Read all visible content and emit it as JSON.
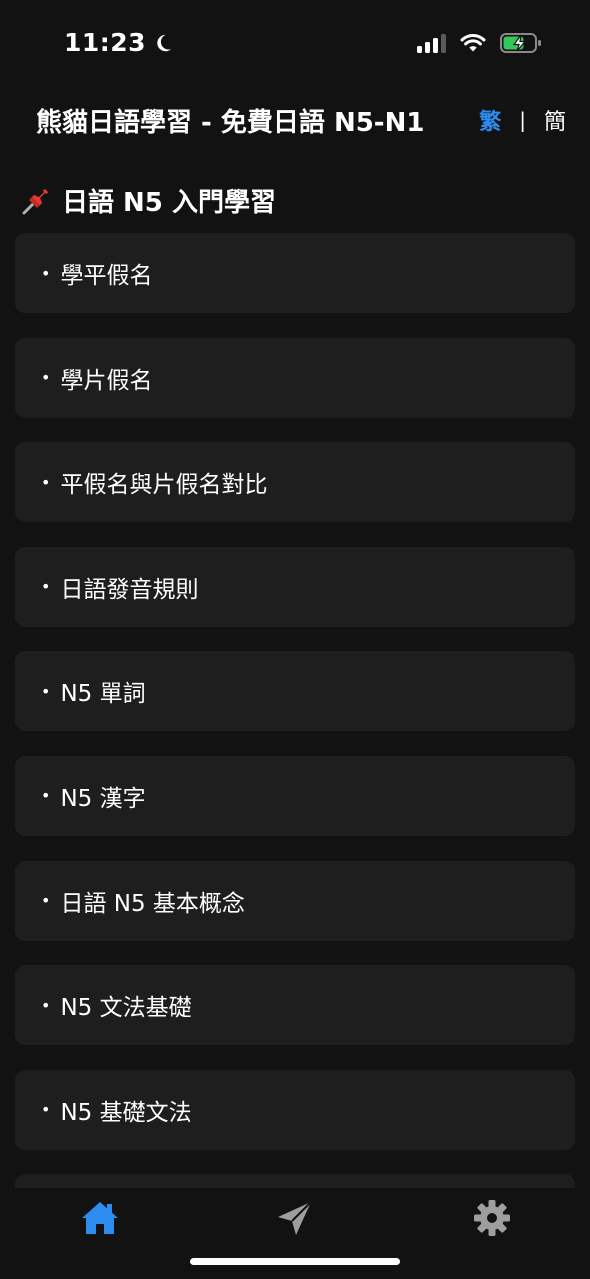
{
  "status_bar": {
    "time": "11:23",
    "icons": [
      "moon-icon",
      "cellular-signal-icon",
      "wifi-icon",
      "battery-charging-icon"
    ]
  },
  "header": {
    "title": "熊貓日語學習 - 免費日語 N5-N1",
    "lang_traditional": "繁",
    "lang_separator": "|",
    "lang_simplified": "簡"
  },
  "section": {
    "emoji": "📌",
    "title": "日語 N5 入門學習",
    "items": [
      {
        "label": "學平假名"
      },
      {
        "label": "學片假名"
      },
      {
        "label": "平假名與片假名對比"
      },
      {
        "label": "日語發音規則"
      },
      {
        "label": "N5 單詞"
      },
      {
        "label": "N5 漢字"
      },
      {
        "label": "日語 N5 基本概念"
      },
      {
        "label": "N5 文法基礎"
      },
      {
        "label": "N5 基礎文法"
      },
      {
        "label": ""
      }
    ]
  },
  "tab_bar": {
    "tabs": [
      {
        "icon": "home-icon",
        "active": true
      },
      {
        "icon": "send-icon",
        "active": false
      },
      {
        "icon": "gear-icon",
        "active": false
      }
    ]
  },
  "colors": {
    "background": "#121212",
    "card": "#1e1e1e",
    "accent": "#2d8cf0",
    "inactive_icon": "#9e9e9e"
  }
}
